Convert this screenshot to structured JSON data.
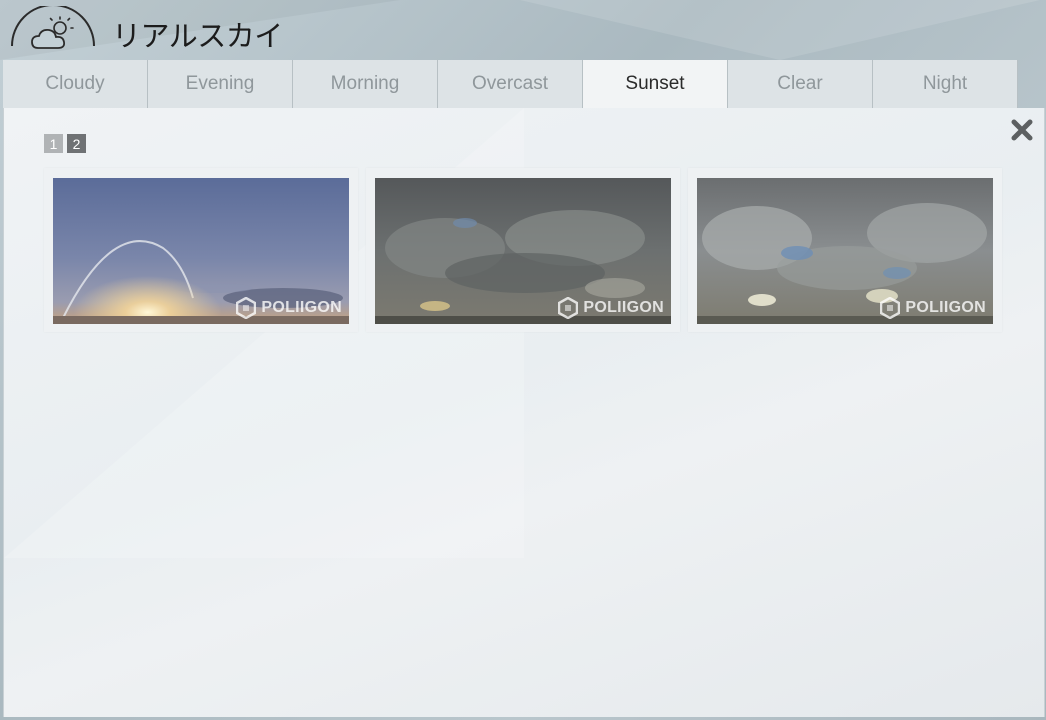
{
  "header": {
    "title": "リアルスカイ",
    "logo_icon": "cloud-sun-icon"
  },
  "tabs": [
    {
      "label": "Cloudy",
      "active": false
    },
    {
      "label": "Evening",
      "active": false
    },
    {
      "label": "Morning",
      "active": false
    },
    {
      "label": "Overcast",
      "active": false
    },
    {
      "label": "Sunset",
      "active": true
    },
    {
      "label": "Clear",
      "active": false
    },
    {
      "label": "Night",
      "active": false
    }
  ],
  "pager": {
    "pages": [
      "1",
      "2"
    ],
    "current": "2"
  },
  "close_icon": "close-icon",
  "thumbnails": [
    {
      "watermark": "POLIIGON"
    },
    {
      "watermark": "POLIIGON"
    },
    {
      "watermark": "POLIIGON"
    }
  ]
}
